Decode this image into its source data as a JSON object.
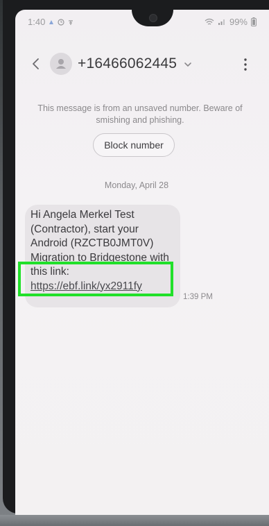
{
  "status_bar": {
    "time": "1:40",
    "battery": "99%"
  },
  "header": {
    "contact_number": "+16466062445"
  },
  "security_notice": {
    "text": "This message is from an unsaved number. Beware of smishing and phishing."
  },
  "block_button": {
    "label": "Block number"
  },
  "conversation": {
    "date_separator": "Monday, April 28",
    "messages": [
      {
        "text_before_link": "Hi Angela Merkel Test (Contractor), start your Android (RZCTB0JMT0V) Migration to Bridgestone with this link: ",
        "link": "https://ebf.link/yx2911fy",
        "time": "1:39 PM"
      }
    ]
  },
  "colors": {
    "highlight": "#21e02a",
    "bubble": "#e7e4e7",
    "screen_bg": "#f3f1f3"
  },
  "icons": [
    "back-icon",
    "avatar-person-icon",
    "chevron-down-icon",
    "more-vert-icon",
    "wifi-icon",
    "signal-icon",
    "battery-icon"
  ]
}
